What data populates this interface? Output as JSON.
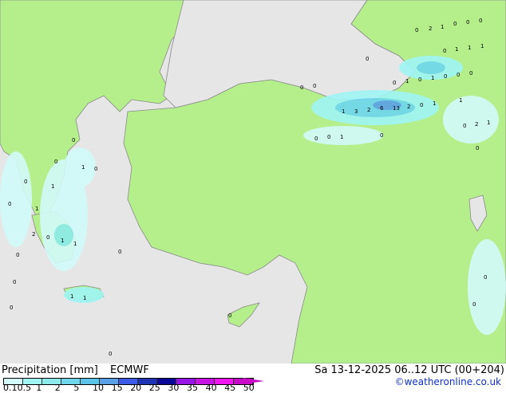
{
  "title": "Precipitation [mm]",
  "model": "ECMWF",
  "valid_time": "Sa 13-12-2025 06..12 UTC (00+204)",
  "credit": "©weatheronline.co.uk",
  "colors": {
    "sea": "#e6e6e6",
    "land": "#b4ef8c",
    "coast": "#8a8a8a"
  },
  "legend": {
    "ticks": [
      "0.1",
      "0.5",
      "1",
      "2",
      "5",
      "10",
      "15",
      "20",
      "25",
      "30",
      "35",
      "40",
      "45",
      "50"
    ],
    "colors": [
      "#d2fafa",
      "#a0f5f5",
      "#8ceaea",
      "#6ed7ee",
      "#5ac3e6",
      "#5aa0e6",
      "#3c5ae6",
      "#1e32b4",
      "#0a0a96",
      "#9614e6",
      "#c814e6",
      "#f014f0",
      "#c80ac8"
    ]
  },
  "point_labels": [
    {
      "v": "0",
      "a": "520,40"
    },
    {
      "v": "2",
      "a": "537,38"
    },
    {
      "v": "1",
      "a": "552,36"
    },
    {
      "v": "0",
      "a": "568,32"
    },
    {
      "v": "0",
      "a": "584,30"
    },
    {
      "v": "0",
      "a": "600,28"
    },
    {
      "v": "0",
      "a": "555,66"
    },
    {
      "v": "1",
      "a": "570,64"
    },
    {
      "v": "1",
      "a": "586,62"
    },
    {
      "v": "1",
      "a": "602,60"
    },
    {
      "v": "0",
      "a": "458,76"
    },
    {
      "v": "0",
      "a": "376,112"
    },
    {
      "v": "0",
      "a": "392,110"
    },
    {
      "v": "0",
      "a": "492,106"
    },
    {
      "v": "1",
      "a": "508,104"
    },
    {
      "v": "0",
      "a": "524,102"
    },
    {
      "v": "1",
      "a": "540,100"
    },
    {
      "v": "0",
      "a": "556,98"
    },
    {
      "v": "0",
      "a": "572,96"
    },
    {
      "v": "0",
      "a": "588,94"
    },
    {
      "v": "1",
      "a": "428,142"
    },
    {
      "v": "3",
      "a": "444,142"
    },
    {
      "v": "2",
      "a": "460,140"
    },
    {
      "v": "6",
      "a": "476,138"
    },
    {
      "v": "13",
      "a": "492,138"
    },
    {
      "v": "2",
      "a": "510,136"
    },
    {
      "v": "0",
      "a": "526,134"
    },
    {
      "v": "1",
      "a": "542,132"
    },
    {
      "v": "1",
      "a": "575,128"
    },
    {
      "v": "0",
      "a": "580,160"
    },
    {
      "v": "2",
      "a": "595,158"
    },
    {
      "v": "1",
      "a": "610,156"
    },
    {
      "v": "0",
      "a": "394,176"
    },
    {
      "v": "0",
      "a": "410,174"
    },
    {
      "v": "1",
      "a": "426,174"
    },
    {
      "v": "0",
      "a": "476,172"
    },
    {
      "v": "0",
      "a": "596,188"
    },
    {
      "v": "0",
      "a": "90,178"
    },
    {
      "v": "0",
      "a": "68,205"
    },
    {
      "v": "1",
      "a": "102,212"
    },
    {
      "v": "0",
      "a": "118,214"
    },
    {
      "v": "0",
      "a": "30,230"
    },
    {
      "v": "1",
      "a": "64,236"
    },
    {
      "v": "0",
      "a": "10,258"
    },
    {
      "v": "1",
      "a": "44,264"
    },
    {
      "v": "2",
      "a": "40,296"
    },
    {
      "v": "0",
      "a": "58,300"
    },
    {
      "v": "1",
      "a": "76,304"
    },
    {
      "v": "1",
      "a": "92,308"
    },
    {
      "v": "0",
      "a": "20,322"
    },
    {
      "v": "0",
      "a": "148,318"
    },
    {
      "v": "0",
      "a": "16,356"
    },
    {
      "v": "1",
      "a": "88,374"
    },
    {
      "v": "1",
      "a": "104,376"
    },
    {
      "v": "0",
      "a": "12,388"
    },
    {
      "v": "0",
      "a": "286,398"
    },
    {
      "v": "0",
      "a": "606,350"
    },
    {
      "v": "0",
      "a": "592,384"
    },
    {
      "v": "0",
      "a": "136,446"
    }
  ]
}
